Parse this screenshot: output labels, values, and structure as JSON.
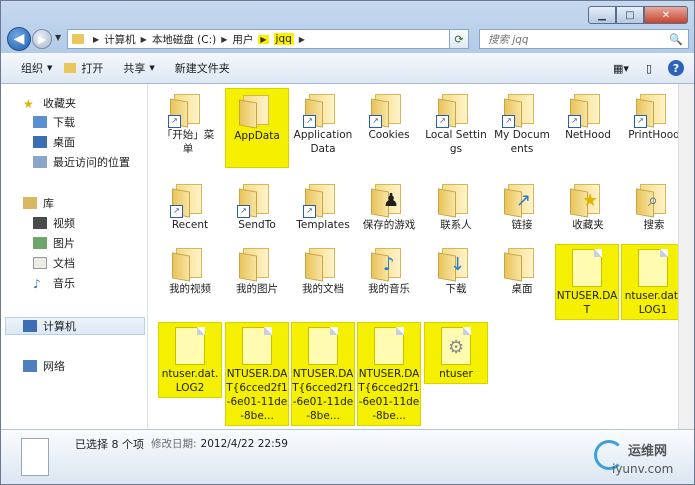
{
  "address": {
    "crumbs": [
      "计算机",
      "本地磁盘 (C:)",
      "用户",
      "jqq"
    ]
  },
  "search": {
    "placeholder": "搜索 jqq"
  },
  "toolbar": {
    "organize": "组织",
    "open": "打开",
    "share": "共享",
    "new_folder": "新建文件夹"
  },
  "sidebar": {
    "favorites": "收藏夹",
    "downloads": "下载",
    "desktop": "桌面",
    "recent": "最近访问的位置",
    "libraries": "库",
    "videos": "视频",
    "pictures": "图片",
    "documents": "文档",
    "music": "音乐",
    "computer": "计算机",
    "network": "网络"
  },
  "items": [
    {
      "label": "「开始」菜单",
      "type": "folder-shortcut"
    },
    {
      "label": "AppData",
      "type": "folder",
      "selected": true
    },
    {
      "label": "Application Data",
      "type": "folder-shortcut"
    },
    {
      "label": "Cookies",
      "type": "folder-shortcut"
    },
    {
      "label": "Local Settings",
      "type": "folder-shortcut"
    },
    {
      "label": "My Documents",
      "type": "folder-shortcut"
    },
    {
      "label": "NetHood",
      "type": "folder-shortcut"
    },
    {
      "label": "PrintHood",
      "type": "folder-shortcut"
    },
    {
      "label": "Recent",
      "type": "folder-shortcut"
    },
    {
      "label": "SendTo",
      "type": "folder-shortcut"
    },
    {
      "label": "Templates",
      "type": "folder-shortcut"
    },
    {
      "label": "保存的游戏",
      "type": "folder"
    },
    {
      "label": "联系人",
      "type": "folder"
    },
    {
      "label": "链接",
      "type": "folder"
    },
    {
      "label": "收藏夹",
      "type": "folder"
    },
    {
      "label": "搜索",
      "type": "folder"
    },
    {
      "label": "我的视频",
      "type": "folder"
    },
    {
      "label": "我的图片",
      "type": "folder"
    },
    {
      "label": "我的文档",
      "type": "folder"
    },
    {
      "label": "我的音乐",
      "type": "folder"
    },
    {
      "label": "下载",
      "type": "folder"
    },
    {
      "label": "桌面",
      "type": "folder"
    },
    {
      "label": "NTUSER.DAT",
      "type": "file",
      "selected": true
    },
    {
      "label": "ntuser.dat.LOG1",
      "type": "file",
      "selected": true
    },
    {
      "label": "ntuser.dat.LOG2",
      "type": "file",
      "selected": true
    },
    {
      "label": "NTUSER.DAT{6cced2f1-6e01-11de-8be...",
      "type": "file",
      "selected": true
    },
    {
      "label": "NTUSER.DAT{6cced2f1-6e01-11de-8be...",
      "type": "file",
      "selected": true
    },
    {
      "label": "NTUSER.DAT{6cced2f1-6e01-11de-8be...",
      "type": "file",
      "selected": true
    },
    {
      "label": "ntuser",
      "type": "settings-file",
      "selected": true
    }
  ],
  "status": {
    "selected_text": "已选择 8 个项",
    "date_key": "修改日期:",
    "date_value": "2012/4/22 22:59"
  },
  "watermark": {
    "line1": "运维网",
    "line2": "iyunv.com"
  },
  "colors": {
    "highlight": "#f4f000",
    "accent": "#2c62b8"
  }
}
